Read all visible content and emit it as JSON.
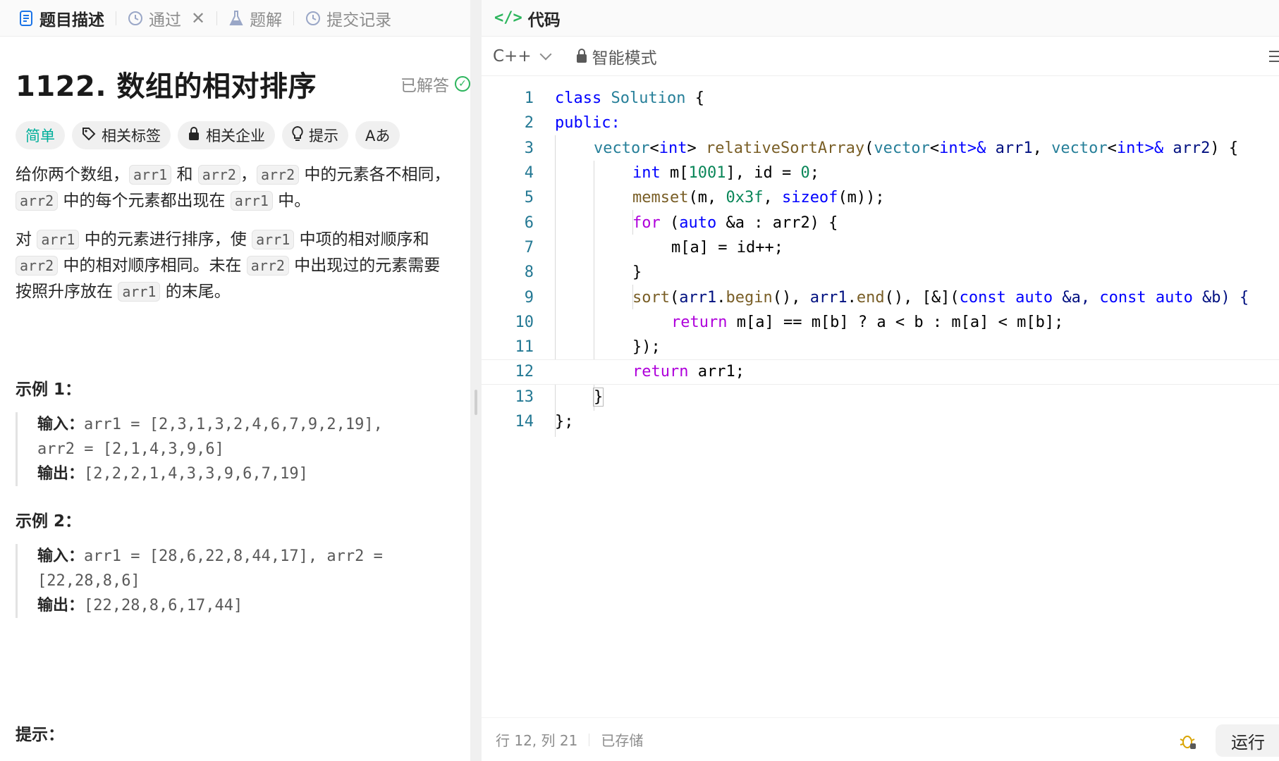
{
  "left_tabs": {
    "description": "题目描述",
    "passed": "通过",
    "solutions": "题解",
    "submissions": "提交记录"
  },
  "problem": {
    "title": "1122. 数组的相对排序",
    "status": "已解答",
    "difficulty": "简单",
    "tags_label": "相关标签",
    "companies_label": "相关企业",
    "hint_label": "提示",
    "translate_label": "Aあ",
    "desc": {
      "p1_a": "给你两个数组，",
      "p1_c1": "arr1",
      "p1_b": " 和 ",
      "p1_c2": "arr2",
      "p1_d": "，",
      "p1_c3": "arr2",
      "p1_e": " 中的元素各不相同，",
      "p1_c4": "arr2",
      "p1_f": " 中的每个元素都出现在 ",
      "p1_c5": "arr1",
      "p1_g": " 中。",
      "p2_a": "对 ",
      "p2_c1": "arr1",
      "p2_b": " 中的元素进行排序，使 ",
      "p2_c2": "arr1",
      "p2_c": " 中项的相对顺序和 ",
      "p2_c3": "arr2",
      "p2_d": " 中的相对顺序相同。未在 ",
      "p2_c4": "arr2",
      "p2_e": " 中出现过的元素需要按照升序放在 ",
      "p2_c5": "arr1",
      "p2_f": " 的末尾。"
    },
    "examples": [
      {
        "title": "示例 1：",
        "input_label": "输入：",
        "input_line1": "arr1 = [2,3,1,3,2,4,6,7,9,2,19],",
        "input_line2": "arr2 = [2,1,4,3,9,6]",
        "output_label": "输出：",
        "output": "[2,2,2,1,4,3,3,9,6,7,19]"
      },
      {
        "title": "示例  2：",
        "input_label": "输入：",
        "input_line1": "arr1 = [28,6,22,8,44,17], arr2 =",
        "input_line2": "[22,28,8,6]",
        "output_label": "输出：",
        "output": "[22,28,8,6,17,44]"
      }
    ],
    "hints_title": "提示："
  },
  "editor": {
    "header_title": "代码",
    "language": "C++",
    "mode": "智能模式",
    "line_numbers": [
      "1",
      "2",
      "3",
      "4",
      "5",
      "6",
      "7",
      "8",
      "9",
      "10",
      "11",
      "12",
      "13",
      "14"
    ],
    "tokens": {
      "l1_class": "class",
      "l1_name": "Solution",
      "l1_brace": " {",
      "l2": "public:",
      "l3_vec": "vector",
      "l3_lt": "<",
      "l3_int": "int",
      "l3_gt": "> ",
      "l3_fn": "relativeSortArray",
      "l3_p1": "(",
      "l3_vec2": "vector",
      "l3_lt2": "<",
      "l3_int2": "int",
      "l3_gt2": ">& ",
      "l3_a1": "arr1",
      "l3_comma": ", ",
      "l3_vec3": "vector",
      "l3_lt3": "<",
      "l3_int3": "int",
      "l3_gt3": ">& ",
      "l3_a2": "arr2",
      "l3_end": ") {",
      "l4_int": "int",
      "l4_m": " m",
      "l4_b1": "[",
      "l4_n": "1001",
      "l4_b2": "], id = ",
      "l4_z": "0",
      "l4_semi": ";",
      "l5_fn": "memset",
      "l5_a": "(m, ",
      "l5_hex": "0x3f",
      "l5_b": ", ",
      "l5_sz": "sizeof",
      "l5_c": "(m));",
      "l6_for": "for",
      "l6_a": " (",
      "l6_auto": "auto",
      "l6_b": " &a : arr2) {",
      "l7": "m[a] = id++;",
      "l8": "}",
      "l9_sort": "sort",
      "l9_a": "(",
      "l9_arr1": "arr1",
      "l9_dot": ".",
      "l9_begin": "begin",
      "l9_b": "(), ",
      "l9_arr1b": "arr1",
      "l9_dot2": ".",
      "l9_end": "end",
      "l9_c": "(), [&](",
      "l9_const": "const",
      "l9_sp": " ",
      "l9_auto": "auto",
      "l9_d": " &a, ",
      "l9_const2": "const",
      "l9_sp2": " ",
      "l9_auto2": "auto",
      "l9_e": " &b) {",
      "l10_ret": "return",
      "l10_a": " m[a] == m[b] ? a < b : m[a] < m[b];",
      "l11": "});",
      "l12_ret": "return",
      "l12_a": " arr1;",
      "l13": "}",
      "l14": "};"
    }
  },
  "status_bar": {
    "cursor": "行 12, 列 21",
    "saved": "已存储",
    "run": "运行"
  },
  "colors": {
    "accent_green": "#2db55d",
    "easy_teal": "#00af9b",
    "keyword_blue": "#0000ff",
    "control_purple": "#af00db",
    "type_teal": "#267f99",
    "function_brown": "#795e26",
    "number_green": "#098658",
    "line_number": "#237893"
  },
  "icons": {
    "description_tab": "document-icon",
    "passed_tab": "history-icon",
    "solutions_tab": "flask-icon",
    "submissions_tab": "history-icon",
    "code_header": "code-icon",
    "tags": "tag-icon",
    "companies": "lock-icon",
    "hint": "bulb-icon",
    "translate": "translate-icon",
    "mode": "lock-icon",
    "menu": "menu-icon",
    "debug": "bug-icon",
    "solved": "check-circle-icon"
  }
}
